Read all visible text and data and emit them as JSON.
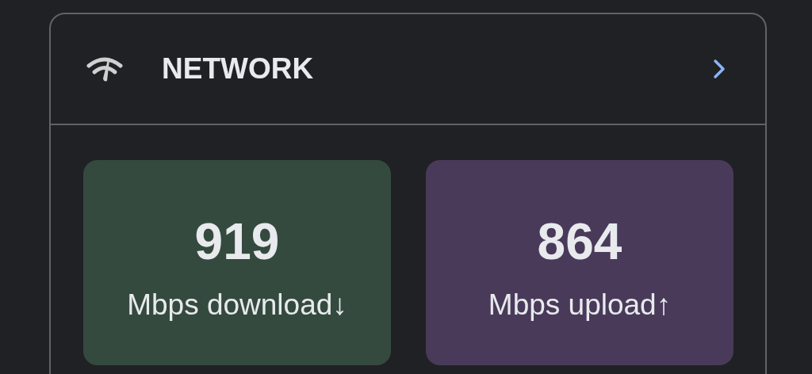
{
  "card": {
    "title": "NETWORK",
    "tiles": [
      {
        "value": "919",
        "label": "Mbps download↓",
        "color": "#344a3e"
      },
      {
        "value": "864",
        "label": "Mbps upload↑",
        "color": "#493a5a"
      }
    ]
  }
}
